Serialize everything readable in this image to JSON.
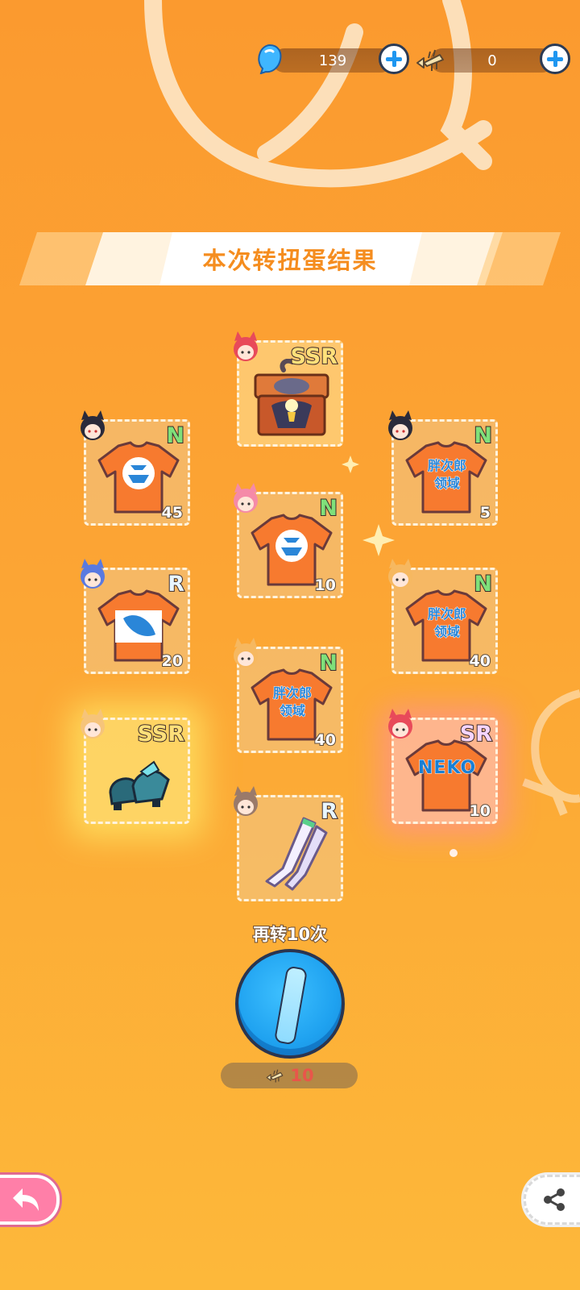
{
  "header": {
    "gem_count": "139",
    "fishbone_count": "0"
  },
  "banner": {
    "title": "本次转扭蛋结果"
  },
  "items": [
    {
      "rarity": "SSR",
      "count": "",
      "kind": "chest"
    },
    {
      "rarity": "N",
      "count": "45",
      "kind": "tee-logo"
    },
    {
      "rarity": "N",
      "count": "5",
      "kind": "tee-text",
      "tee_text": "胖次郎\n领域"
    },
    {
      "rarity": "N",
      "count": "10",
      "kind": "tee-logo"
    },
    {
      "rarity": "R",
      "count": "20",
      "kind": "tee-leaf"
    },
    {
      "rarity": "N",
      "count": "40",
      "kind": "tee-text",
      "tee_text": "胖次郎\n领域"
    },
    {
      "rarity": "N",
      "count": "40",
      "kind": "tee-text",
      "tee_text": "胖次郎\n领域"
    },
    {
      "rarity": "SSR",
      "count": "",
      "kind": "shoes"
    },
    {
      "rarity": "SR",
      "count": "10",
      "kind": "tee-neko",
      "tee_text": "NEKO"
    },
    {
      "rarity": "R",
      "count": "",
      "kind": "stockings"
    }
  ],
  "spin_again": {
    "label": "再转10次",
    "cost": "10"
  },
  "colors": {
    "background": "#fca534",
    "banner_text": "#f58d1f",
    "spin_button": "#1fa2f0",
    "rarity_N": "#7fe07a",
    "rarity_SSR": "#ffe07a"
  },
  "icons": [
    "gem-icon",
    "fishbone-icon",
    "plus-icon",
    "back-arrow-icon",
    "share-icon"
  ]
}
